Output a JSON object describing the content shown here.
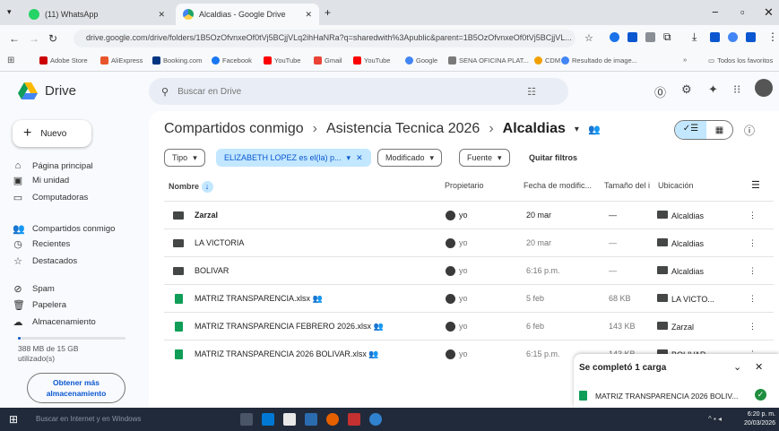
{
  "browser": {
    "tabs": [
      {
        "label": "(11) WhatsApp",
        "active": false
      },
      {
        "label": "Alcaldias - Google Drive",
        "active": true
      }
    ],
    "new_tab": "+",
    "url": "drive.google.com/drive/folders/1B5OzOfvnxeOf0tVj5BCjjVLq2ihHaNRa?q=sharedwith%3Apublic&parent=1B5OzOfvnxeOf0tVj5BCjjVL...",
    "bookmarks": [
      "Adobe Store",
      "AliExpress",
      "Booking.com",
      "Facebook",
      "YouTube",
      "Gmail",
      "YouTube",
      "Google",
      "SENA OFICINA PLAT...",
      "CDM",
      "Resultado de image..."
    ],
    "all_bookmarks": "Todos los favoritos"
  },
  "drive": {
    "app_name": "Drive",
    "search_placeholder": "Buscar en Drive",
    "new_button": "Nuevo",
    "sidebar": [
      {
        "label": "Página principal",
        "icon": "home-icon"
      },
      {
        "label": "Mi unidad",
        "icon": "my-drive-icon"
      },
      {
        "label": "Computadoras",
        "icon": "computer-icon"
      },
      {
        "label": "Compartidos conmigo",
        "icon": "shared-icon"
      },
      {
        "label": "Recientes",
        "icon": "clock-icon"
      },
      {
        "label": "Destacados",
        "icon": "star-icon"
      },
      {
        "label": "Spam",
        "icon": "spam-icon"
      },
      {
        "label": "Papelera",
        "icon": "trash-icon"
      },
      {
        "label": "Almacenamiento",
        "icon": "cloud-icon"
      }
    ],
    "storage_line1": "388 MB de 15 GB",
    "storage_line2": "utilizado(s)",
    "storage_fraction": 0.026,
    "storage_button": [
      "Obtener más",
      "almacenamiento"
    ],
    "breadcrumb": [
      "Compartidos conmigo",
      "Asistencia Tecnica 2026",
      "Alcaldias"
    ],
    "filters": {
      "tipo": "Tipo",
      "person": "ELIZABETH LOPEZ es el(la) p...",
      "modificado": "Modificado",
      "fuente": "Fuente",
      "clear": "Quitar filtros"
    },
    "columns": {
      "name": "Nombre",
      "owner": "Propietario",
      "modified": "Fecha de modific...",
      "size": "Tamaño del i",
      "location": "Ubicación"
    },
    "files": [
      {
        "name": "Zarzal",
        "type": "folder",
        "owner": "yo",
        "modified": "20 mar",
        "size": "—",
        "location": "Alcaldias",
        "shared": false
      },
      {
        "name": "LA VICTORIA",
        "type": "folder",
        "owner": "yo",
        "modified": "20 mar",
        "size": "—",
        "location": "Alcaldias",
        "shared": false
      },
      {
        "name": "BOLIVAR",
        "type": "folder",
        "owner": "yo",
        "modified": "6:16 p.m.",
        "size": "—",
        "location": "Alcaldias",
        "shared": false
      },
      {
        "name": "MATRIZ TRANSPARENCIA.xlsx",
        "type": "sheet",
        "owner": "yo",
        "modified": "5 feb",
        "size": "68 KB",
        "location": "LA VICTO...",
        "shared": true
      },
      {
        "name": "MATRIZ TRANSPARENCIA FEBRERO 2026.xlsx",
        "type": "sheet",
        "owner": "yo",
        "modified": "6 feb",
        "size": "143 KB",
        "location": "Zarzal",
        "shared": true
      },
      {
        "name": "MATRIZ TRANSPARENCIA 2026 BOLIVAR.xlsx",
        "type": "sheet",
        "owner": "yo",
        "modified": "6:15 p.m.",
        "size": "143 KB",
        "location": "BOLIVAR",
        "shared": true
      }
    ],
    "upload": {
      "title": "Se completó 1 carga",
      "file": "MATRIZ TRANSPARENCIA 2026 BOLIV..."
    }
  },
  "taskbar": {
    "search": "Buscar en Internet y en Windows",
    "time": "6:20 p. m.",
    "date": "20/03/2026"
  },
  "colors": {
    "accent": "#0b57d0",
    "chip_blue": "#c2e7ff",
    "taskbar": "#202a3a"
  }
}
